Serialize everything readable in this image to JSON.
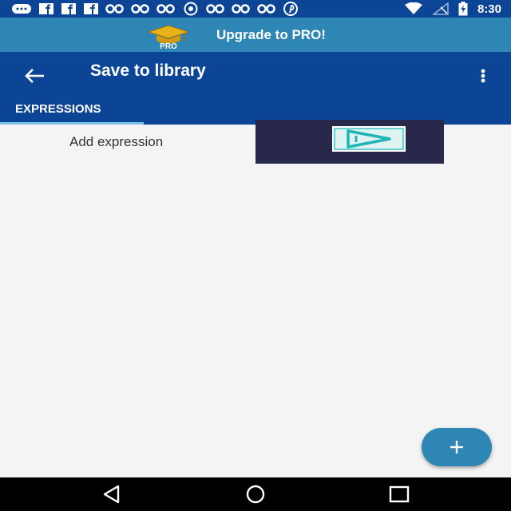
{
  "status_bar": {
    "time": "8:30",
    "left_icons": [
      "chat-bubble-icon",
      "facebook-icon",
      "facebook-icon",
      "facebook-icon",
      "notification-icon",
      "notification-icon",
      "notification-icon",
      "bbm-icon",
      "notification-icon",
      "notification-icon",
      "notification-icon",
      "pinterest-icon"
    ],
    "right_icons": [
      "wifi-icon",
      "no-signal-icon",
      "battery-charging-icon"
    ]
  },
  "promo": {
    "label": "Upgrade to PRO!",
    "badge": "PRO",
    "icon": "graduation-cap-icon"
  },
  "app_bar": {
    "title": "Save to library",
    "back_icon": "arrow-left-icon",
    "menu_icon": "more-vert-icon",
    "tab_label": "EXPRESSIONS"
  },
  "content": {
    "add_expression_label": "Add expression"
  },
  "fab": {
    "icon": "plus-icon"
  },
  "nav": {
    "buttons": [
      "back-triangle-icon",
      "home-circle-icon",
      "recents-square-icon"
    ]
  },
  "colors": {
    "primary": "#0d4596",
    "accent": "#2e86b5",
    "tab_indicator": "#7cc3ea",
    "background": "#f4f4f4"
  }
}
